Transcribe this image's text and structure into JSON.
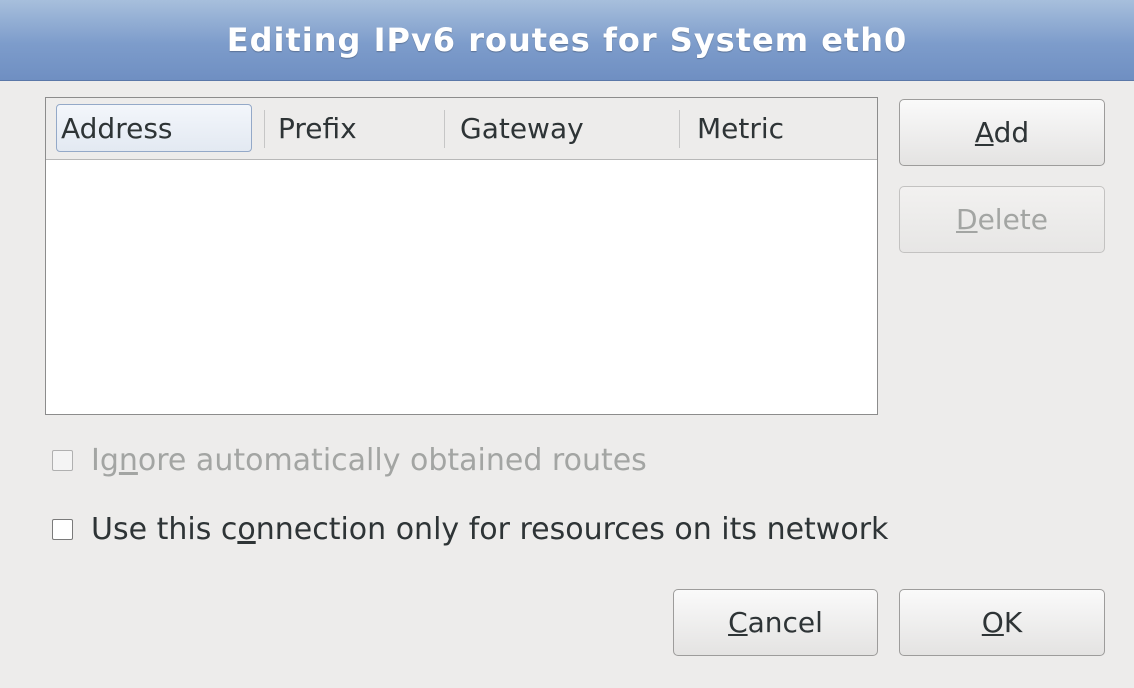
{
  "window": {
    "title": "Editing IPv6 routes for System eth0"
  },
  "routes_table": {
    "columns": [
      "Address",
      "Prefix",
      "Gateway",
      "Metric"
    ],
    "rows": []
  },
  "buttons": {
    "add": {
      "pre": "",
      "mnemonic": "A",
      "post": "dd"
    },
    "delete": {
      "pre": "",
      "mnemonic": "D",
      "post": "elete"
    },
    "cancel": {
      "pre": "",
      "mnemonic": "C",
      "post": "ancel"
    },
    "ok": {
      "pre": "",
      "mnemonic": "O",
      "post": "K"
    }
  },
  "options": {
    "ignore_auto_routes": {
      "pre": "Ig",
      "mnemonic": "n",
      "post": "ore automatically obtained routes",
      "checked": false,
      "enabled": false
    },
    "only_local_resources": {
      "pre": "Use this c",
      "mnemonic": "o",
      "post": "nnection only for resources on its network",
      "checked": false,
      "enabled": true
    }
  },
  "colors": {
    "titlebar": "#7d9ccb",
    "background": "#edeceb",
    "disabled_text": "#a3a5a3"
  }
}
